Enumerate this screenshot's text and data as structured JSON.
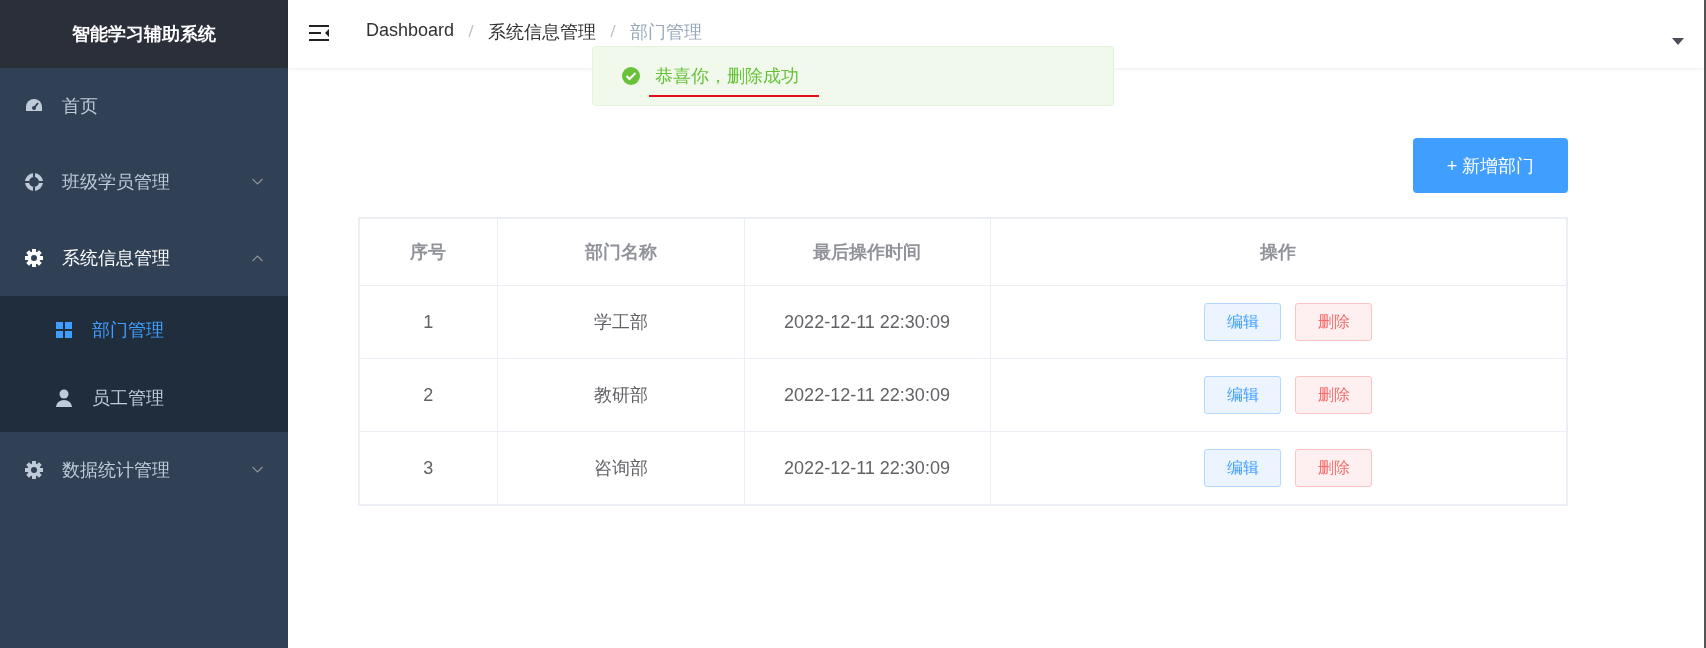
{
  "sidebar": {
    "logo": "智能学习辅助系统",
    "items": [
      {
        "label": "首页"
      },
      {
        "label": "班级学员管理",
        "expanded": false
      },
      {
        "label": "系统信息管理",
        "expanded": true,
        "children": [
          {
            "label": "部门管理",
            "selected": true
          },
          {
            "label": "员工管理",
            "selected": false
          }
        ]
      },
      {
        "label": "数据统计管理",
        "expanded": false
      }
    ]
  },
  "breadcrumb": [
    "Dashboard",
    "系统信息管理",
    "部门管理"
  ],
  "message": {
    "text": "恭喜你，删除成功",
    "underlined": true
  },
  "add_button": "+ 新增部门",
  "table": {
    "columns": [
      "序号",
      "部门名称",
      "最后操作时间",
      "操作"
    ],
    "rows": [
      {
        "index": "1",
        "name": "学工部",
        "time": "2022-12-11 22:30:09",
        "actions": [
          "编辑",
          "删除"
        ]
      },
      {
        "index": "2",
        "name": "教研部",
        "time": "2022-12-11 22:30:09",
        "actions": [
          "编辑",
          "删除"
        ]
      },
      {
        "index": "3",
        "name": "咨询部",
        "time": "2022-12-11 22:30:09",
        "actions": [
          "编辑",
          "删除"
        ]
      }
    ]
  }
}
